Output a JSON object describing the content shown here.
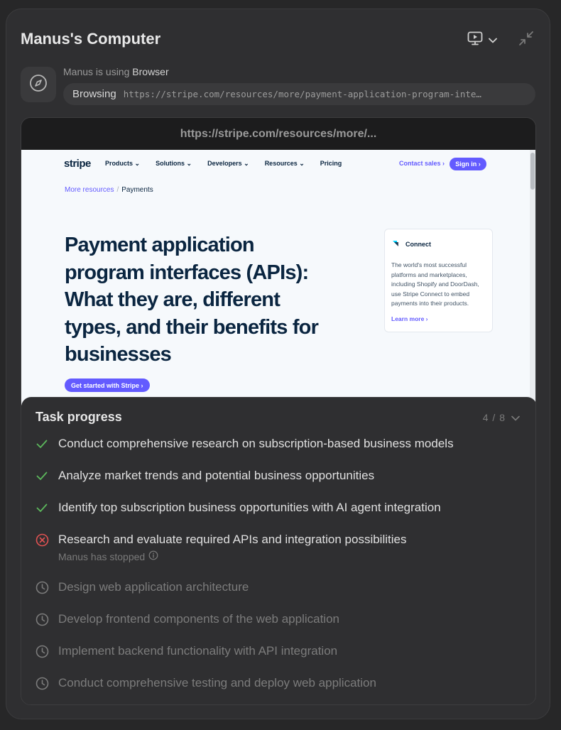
{
  "window": {
    "title": "Manus's Computer"
  },
  "tool": {
    "status_prefix": "Manus is using",
    "tool_name": "Browser",
    "action_label": "Browsing",
    "url": "https://stripe.com/resources/more/payment-application-program-inte…"
  },
  "browser": {
    "address": "https://stripe.com/resources/more/..."
  },
  "stripe_page": {
    "logo": "stripe",
    "nav": [
      "Products ⌄",
      "Solutions ⌄",
      "Developers ⌄",
      "Resources ⌄",
      "Pricing"
    ],
    "contact": "Contact sales ›",
    "signin": "Sign in ›",
    "breadcrumb": {
      "parent": "More resources",
      "separator": "/",
      "current": "Payments"
    },
    "headline": "Payment application program interfaces (APIs): What they are, different types, and their benefits for businesses",
    "cta": "Get started with Stripe ›",
    "card": {
      "title": "Connect",
      "body": "The world's most successful platforms and marketplaces, including Shopify and DoorDash, use Stripe Connect to embed payments into their products.",
      "link": "Learn more ›"
    }
  },
  "task_progress": {
    "title": "Task progress",
    "count": "4 / 8",
    "colors": {
      "done": "#5cb85c",
      "error": "#e05252",
      "pending": "#7c7c7c"
    },
    "tasks": [
      {
        "status": "done",
        "icon": "check-icon",
        "text": "Conduct comprehensive research on subscription-based business models"
      },
      {
        "status": "done",
        "icon": "check-icon",
        "text": "Analyze market trends and potential business opportunities"
      },
      {
        "status": "done",
        "icon": "check-icon",
        "text": "Identify top subscription business opportunities with AI agent integration"
      },
      {
        "status": "error",
        "icon": "error-icon",
        "text": "Research and evaluate required APIs and integration possibilities",
        "note": "Manus has stopped"
      },
      {
        "status": "pending",
        "icon": "clock-icon",
        "text": "Design web application architecture"
      },
      {
        "status": "pending",
        "icon": "clock-icon",
        "text": "Develop frontend components of the web application"
      },
      {
        "status": "pending",
        "icon": "clock-icon",
        "text": "Implement backend functionality with API integration"
      },
      {
        "status": "pending",
        "icon": "clock-icon",
        "text": "Conduct comprehensive testing and deploy web application"
      }
    ]
  }
}
